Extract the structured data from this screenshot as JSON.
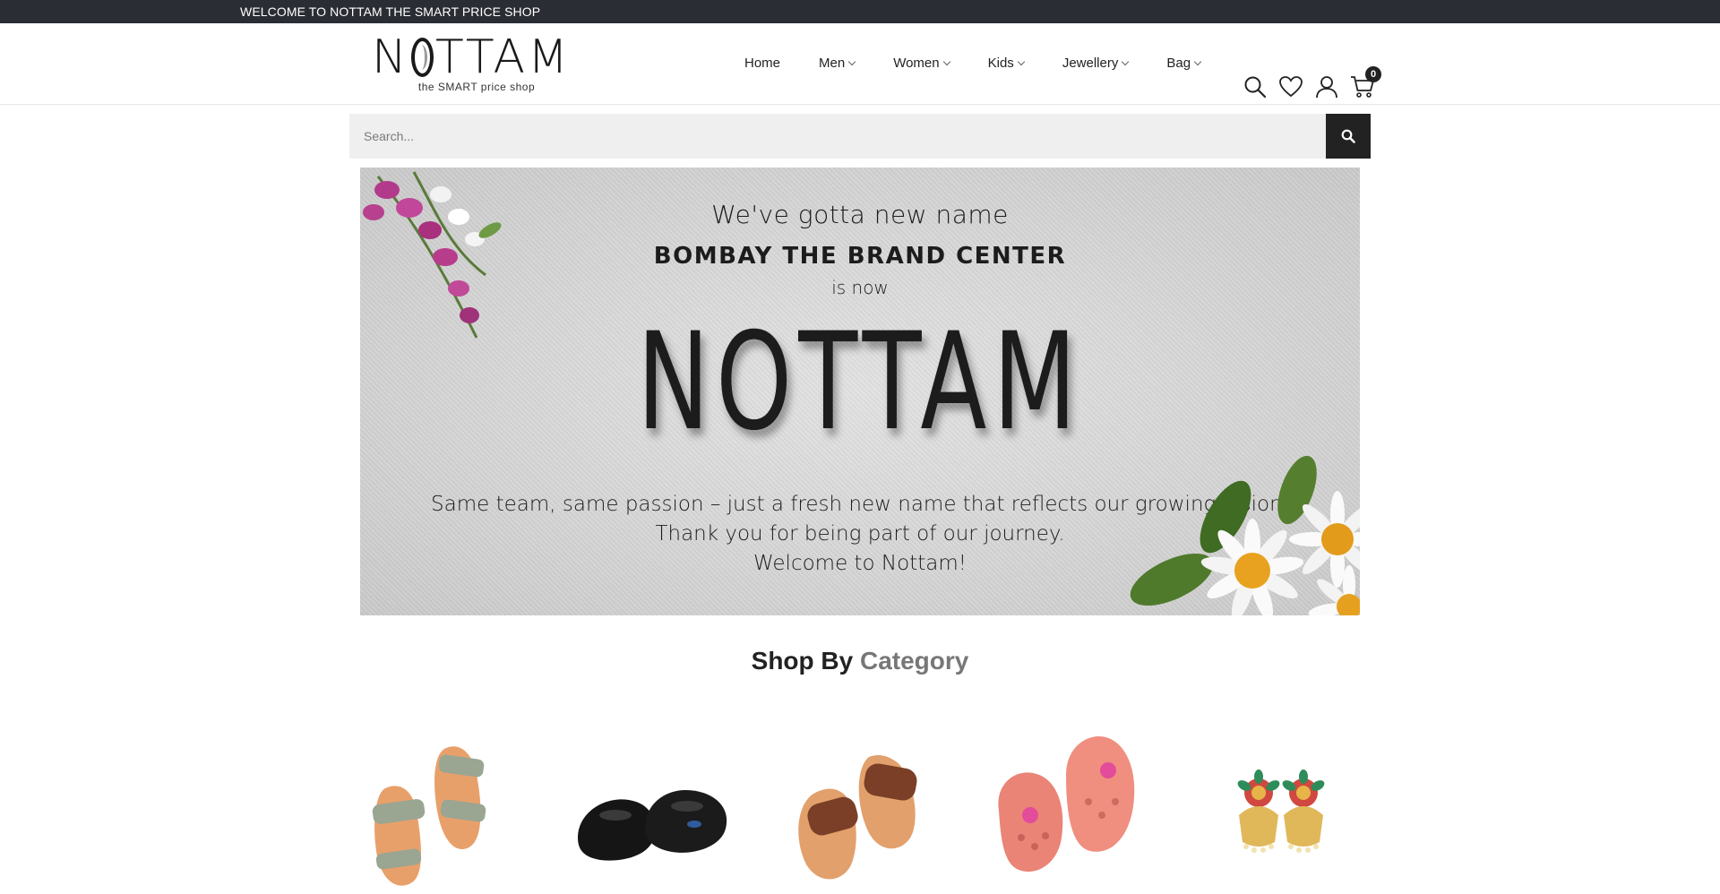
{
  "topbar": {
    "welcome": "WELCOME TO NOTTAM THE SMART PRICE SHOP"
  },
  "logo": {
    "word_n": "N",
    "word_rest": "TTAM",
    "tagline": "the SMART price shop"
  },
  "nav": {
    "items": [
      {
        "label": "Home",
        "dropdown": false
      },
      {
        "label": "Men",
        "dropdown": true
      },
      {
        "label": "Women",
        "dropdown": true
      },
      {
        "label": "Kids",
        "dropdown": true
      },
      {
        "label": "Jewellery",
        "dropdown": true
      },
      {
        "label": "Bag",
        "dropdown": true
      }
    ]
  },
  "header_icons": {
    "search": "search-icon",
    "wishlist": "heart-icon",
    "account": "user-icon",
    "cart": "cart-icon",
    "cart_count": "0"
  },
  "search": {
    "placeholder": "Search...",
    "value": ""
  },
  "banner": {
    "line1": "We've gotta new name",
    "line2": "BOMBAY THE BRAND CENTER",
    "line3": "is now",
    "line4": "NOTTAM",
    "line5": "Same team, same passion – just a fresh new name that reflects our growing vision.",
    "line6": "Thank you for being part of our journey.",
    "line7": "Welcome to Nottam!"
  },
  "section": {
    "title_main": "Shop By",
    "title_accent": "Category"
  },
  "categories": [
    {
      "icon": "women-sandal-image"
    },
    {
      "icon": "school-shoes-image"
    },
    {
      "icon": "men-slipper-image"
    },
    {
      "icon": "kids-clog-image"
    },
    {
      "icon": "earrings-image"
    }
  ],
  "colors": {
    "topbar": "#2a2d33",
    "accent_text": "#777777",
    "dark": "#222222"
  }
}
